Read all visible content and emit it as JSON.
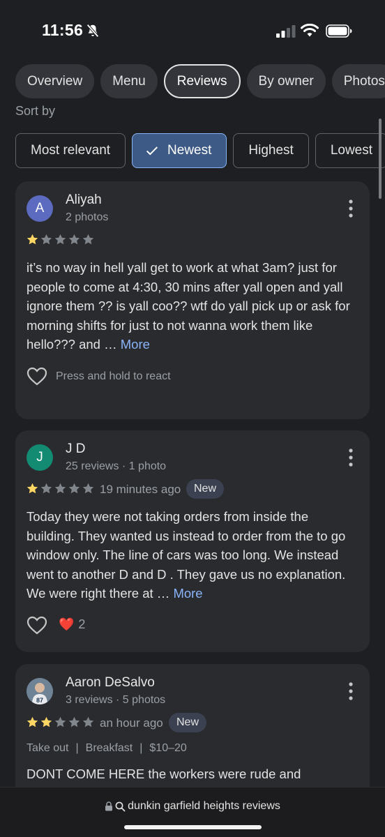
{
  "status": {
    "time": "11:56",
    "icons": [
      "bell-off-icon",
      "cellular-signal-icon",
      "wifi-icon",
      "battery-icon"
    ]
  },
  "tabs": [
    {
      "label": "Overview",
      "active": false
    },
    {
      "label": "Menu",
      "active": false
    },
    {
      "label": "Reviews",
      "active": true
    },
    {
      "label": "By owner",
      "active": false
    },
    {
      "label": "Photos",
      "active": false
    }
  ],
  "sort": {
    "label": "Sort by",
    "options": [
      {
        "label": "Most relevant",
        "selected": false
      },
      {
        "label": "Newest",
        "selected": true
      },
      {
        "label": "Highest",
        "selected": false
      },
      {
        "label": "Lowest",
        "selected": false
      }
    ]
  },
  "reviews": [
    {
      "avatar_letter": "A",
      "avatar_color": "#5c6bc0",
      "name": "Aliyah",
      "meta": "2 photos",
      "rating": 1,
      "text": "it’s no way in hell yall get to work at what 3am? just for people to come at 4:30, 30 mins after yall open and yall ignore them ?? is yall coo?? wtf do yall pick up or ask for morning shifts for just to not wanna work them like hello??? and … ",
      "more": "More",
      "react_hint": "Press and hold to react"
    },
    {
      "avatar_letter": "J",
      "avatar_color": "#138a72",
      "name": "J D",
      "meta": "25 reviews · 1 photo",
      "rating": 1,
      "time": "19 minutes ago",
      "badge": "New",
      "text": "Today they were not taking orders from inside the building. They wanted us instead to order from the to go window only. The line of cars was too long. We instead went to another D and D . They gave us no explanation. We were right there at … ",
      "more": "More",
      "reaction_emoji": "❤️",
      "reaction_count": "2"
    },
    {
      "name": "Aaron DeSalvo",
      "meta": "3 reviews · 5 photos",
      "rating": 2,
      "time": "an hour ago",
      "badge": "New",
      "attributes": [
        "Take out",
        "|",
        "Breakfast",
        "|",
        "$10–20"
      ],
      "text": "DONT COME HERE the workers were rude and"
    }
  ],
  "star_colors": {
    "filled": "#fdd663",
    "empty": "#80868b"
  },
  "browser": {
    "url": "dunkin garfield heights reviews"
  }
}
